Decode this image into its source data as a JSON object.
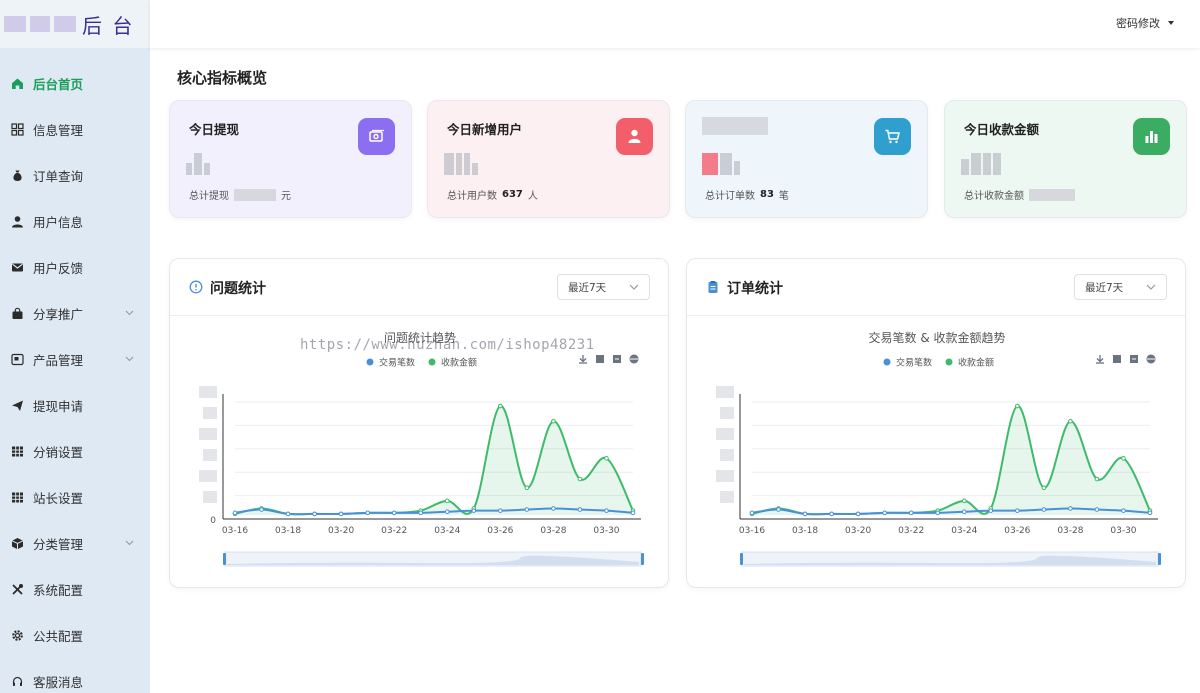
{
  "sidebar": {
    "logo_text": "后 台",
    "items": [
      {
        "label": "后台首页",
        "icon": "home-icon",
        "active": true,
        "has_caret": false
      },
      {
        "label": "信息管理",
        "icon": "grid-icon",
        "active": false,
        "has_caret": false
      },
      {
        "label": "订单查询",
        "icon": "money-bag-icon",
        "active": false,
        "has_caret": false
      },
      {
        "label": "用户信息",
        "icon": "user-icon",
        "active": false,
        "has_caret": false
      },
      {
        "label": "用户反馈",
        "icon": "envelope-icon",
        "active": false,
        "has_caret": false
      },
      {
        "label": "分享推广",
        "icon": "bag-icon",
        "active": false,
        "has_caret": true
      },
      {
        "label": "产品管理",
        "icon": "product-icon",
        "active": false,
        "has_caret": true
      },
      {
        "label": "提现申请",
        "icon": "send-icon",
        "active": false,
        "has_caret": false
      },
      {
        "label": "分销设置",
        "icon": "table-icon",
        "active": false,
        "has_caret": false
      },
      {
        "label": "站长设置",
        "icon": "table-icon",
        "active": false,
        "has_caret": false
      },
      {
        "label": "分类管理",
        "icon": "cube-icon",
        "active": false,
        "has_caret": true
      },
      {
        "label": "系统配置",
        "icon": "tools-icon",
        "active": false,
        "has_caret": false
      },
      {
        "label": "公共配置",
        "icon": "gear-icon",
        "active": false,
        "has_caret": false
      },
      {
        "label": "客服消息",
        "icon": "headset-icon",
        "active": false,
        "has_caret": false
      }
    ]
  },
  "header": {
    "user_menu_label": "密码修改"
  },
  "overview": {
    "title": "核心指标概览",
    "cards": [
      {
        "title": "今日提现",
        "sub_prefix": "总计提现",
        "sub_value": "",
        "sub_suffix": "元",
        "icon": "money-icon",
        "bg": "#f2f0fc",
        "icon_bg": "#8c6ff0"
      },
      {
        "title": "今日新增用户",
        "sub_prefix": "总计用户数",
        "sub_value": "637",
        "sub_suffix": "人",
        "icon": "user-icon",
        "bg": "#fdf0f2",
        "icon_bg": "#f25f6b"
      },
      {
        "title": "",
        "sub_prefix": "总计订单数",
        "sub_value": "83",
        "sub_suffix": "笔",
        "icon": "cart-icon",
        "bg": "#eef5fb",
        "icon_bg": "#2f9fcf"
      },
      {
        "title": "今日收款金额",
        "sub_prefix": "总计收款金额",
        "sub_value": "",
        "sub_suffix": "",
        "icon": "bar-chart-icon",
        "bg": "#eef8f2",
        "icon_bg": "#3aad63"
      }
    ]
  },
  "panels": [
    {
      "title": "问题统计",
      "icon": "info-circle-icon",
      "select_value": "最近7天"
    },
    {
      "title": "订单统计",
      "icon": "clipboard-icon",
      "select_value": "最近7天"
    }
  ],
  "watermark": "https://www.huzhan.com/ishop48231",
  "chart_data": [
    {
      "type": "line",
      "title": "问题统计趋势",
      "x": [
        "03-16",
        "03-17",
        "03-18",
        "03-19",
        "03-20",
        "03-21",
        "03-22",
        "03-23",
        "03-24",
        "03-25",
        "03-26",
        "03-27",
        "03-28",
        "03-29",
        "03-30",
        "03-31"
      ],
      "x_tick_labels": [
        "03-16",
        "03-18",
        "03-20",
        "03-22",
        "03-24",
        "03-26",
        "03-28",
        "03-30"
      ],
      "series": [
        {
          "name": "交易笔数",
          "color": "#4a90d9",
          "values": [
            0.02,
            0.05,
            0.01,
            0.01,
            0.01,
            0.02,
            0.02,
            0.02,
            0.03,
            0.04,
            0.04,
            0.05,
            0.06,
            0.05,
            0.04,
            0.02
          ]
        },
        {
          "name": "收款金额",
          "color": "#3dbb6a",
          "values": [
            0.01,
            0.06,
            0.01,
            0.01,
            0.01,
            0.02,
            0.02,
            0.04,
            0.13,
            0.06,
            1.0,
            0.25,
            0.86,
            0.33,
            0.52,
            0.04
          ]
        }
      ],
      "y_min_label": "0",
      "legend_position": "top-center",
      "grid": true,
      "toolbox_icons": [
        "download-icon",
        "data-view-icon",
        "restore-icon",
        "magic-icon"
      ]
    },
    {
      "type": "line",
      "title": "交易笔数 & 收款金额趋势",
      "x": [
        "03-16",
        "03-17",
        "03-18",
        "03-19",
        "03-20",
        "03-21",
        "03-22",
        "03-23",
        "03-24",
        "03-25",
        "03-26",
        "03-27",
        "03-28",
        "03-29",
        "03-30",
        "03-31"
      ],
      "x_tick_labels": [
        "03-16",
        "03-18",
        "03-20",
        "03-22",
        "03-24",
        "03-26",
        "03-28",
        "03-30"
      ],
      "series": [
        {
          "name": "交易笔数",
          "color": "#4a90d9",
          "values": [
            0.02,
            0.05,
            0.01,
            0.01,
            0.01,
            0.02,
            0.02,
            0.02,
            0.03,
            0.04,
            0.04,
            0.05,
            0.06,
            0.05,
            0.04,
            0.02
          ]
        },
        {
          "name": "收款金额",
          "color": "#3dbb6a",
          "values": [
            0.01,
            0.06,
            0.01,
            0.01,
            0.01,
            0.02,
            0.02,
            0.04,
            0.13,
            0.06,
            1.0,
            0.25,
            0.86,
            0.33,
            0.52,
            0.04
          ]
        }
      ],
      "y_min_label": "",
      "legend_position": "top-center",
      "grid": true,
      "toolbox_icons": [
        "download-icon",
        "data-view-icon",
        "restore-icon",
        "magic-icon"
      ]
    }
  ]
}
